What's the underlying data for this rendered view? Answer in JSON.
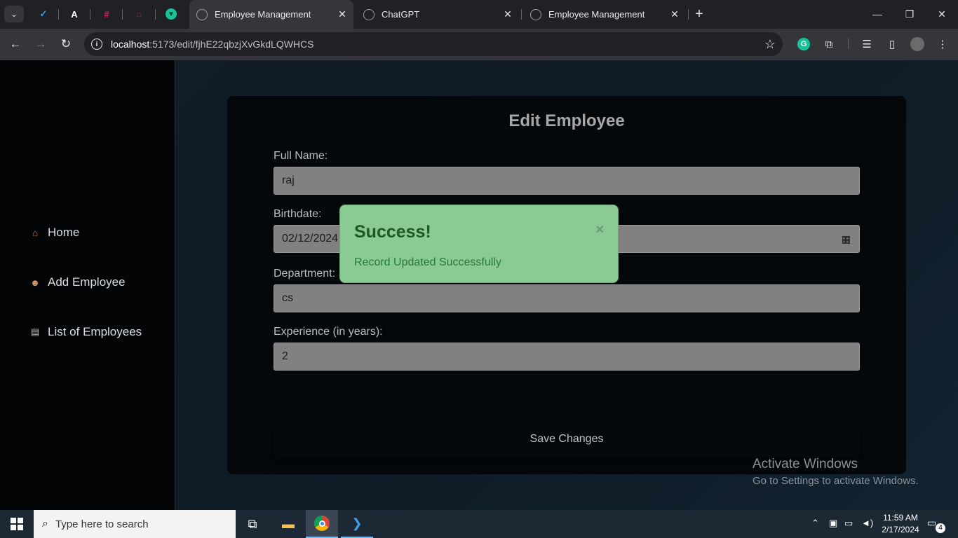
{
  "browser": {
    "tabs": [
      {
        "title": "Employee Management",
        "active": true
      },
      {
        "title": "ChatGPT",
        "active": false
      },
      {
        "title": "Employee Management",
        "active": false
      }
    ],
    "url": "localhost:5173/edit/fjhE22qbzjXvGkdLQWHCS",
    "url_host": "localhost",
    "url_rest": ":5173/edit/fjhE22qbzjXvGkdLQWHCS"
  },
  "sidebar": {
    "items": [
      {
        "label": "Home",
        "icon": "house-icon"
      },
      {
        "label": "Add Employee",
        "icon": "person-icon"
      },
      {
        "label": "List of Employees",
        "icon": "document-icon"
      }
    ]
  },
  "form": {
    "title": "Edit Employee",
    "fields": [
      {
        "label": "Full Name:",
        "value": "raj"
      },
      {
        "label": "Birthdate:",
        "value": "02/12/2024"
      },
      {
        "label": "Department:",
        "value": "cs"
      },
      {
        "label": "Experience (in years):",
        "value": "2"
      }
    ],
    "save_label": "Save Changes"
  },
  "toast": {
    "title": "Success!",
    "close": "×",
    "message": "Record Updated Successfully",
    "color": "#89ca95"
  },
  "watermark": {
    "line1": "Activate Windows",
    "line2": "Go to Settings to activate Windows."
  },
  "taskbar": {
    "search_placeholder": "Type here to search",
    "time": "11:59 AM",
    "date": "2/17/2024",
    "notification_count": "4"
  }
}
